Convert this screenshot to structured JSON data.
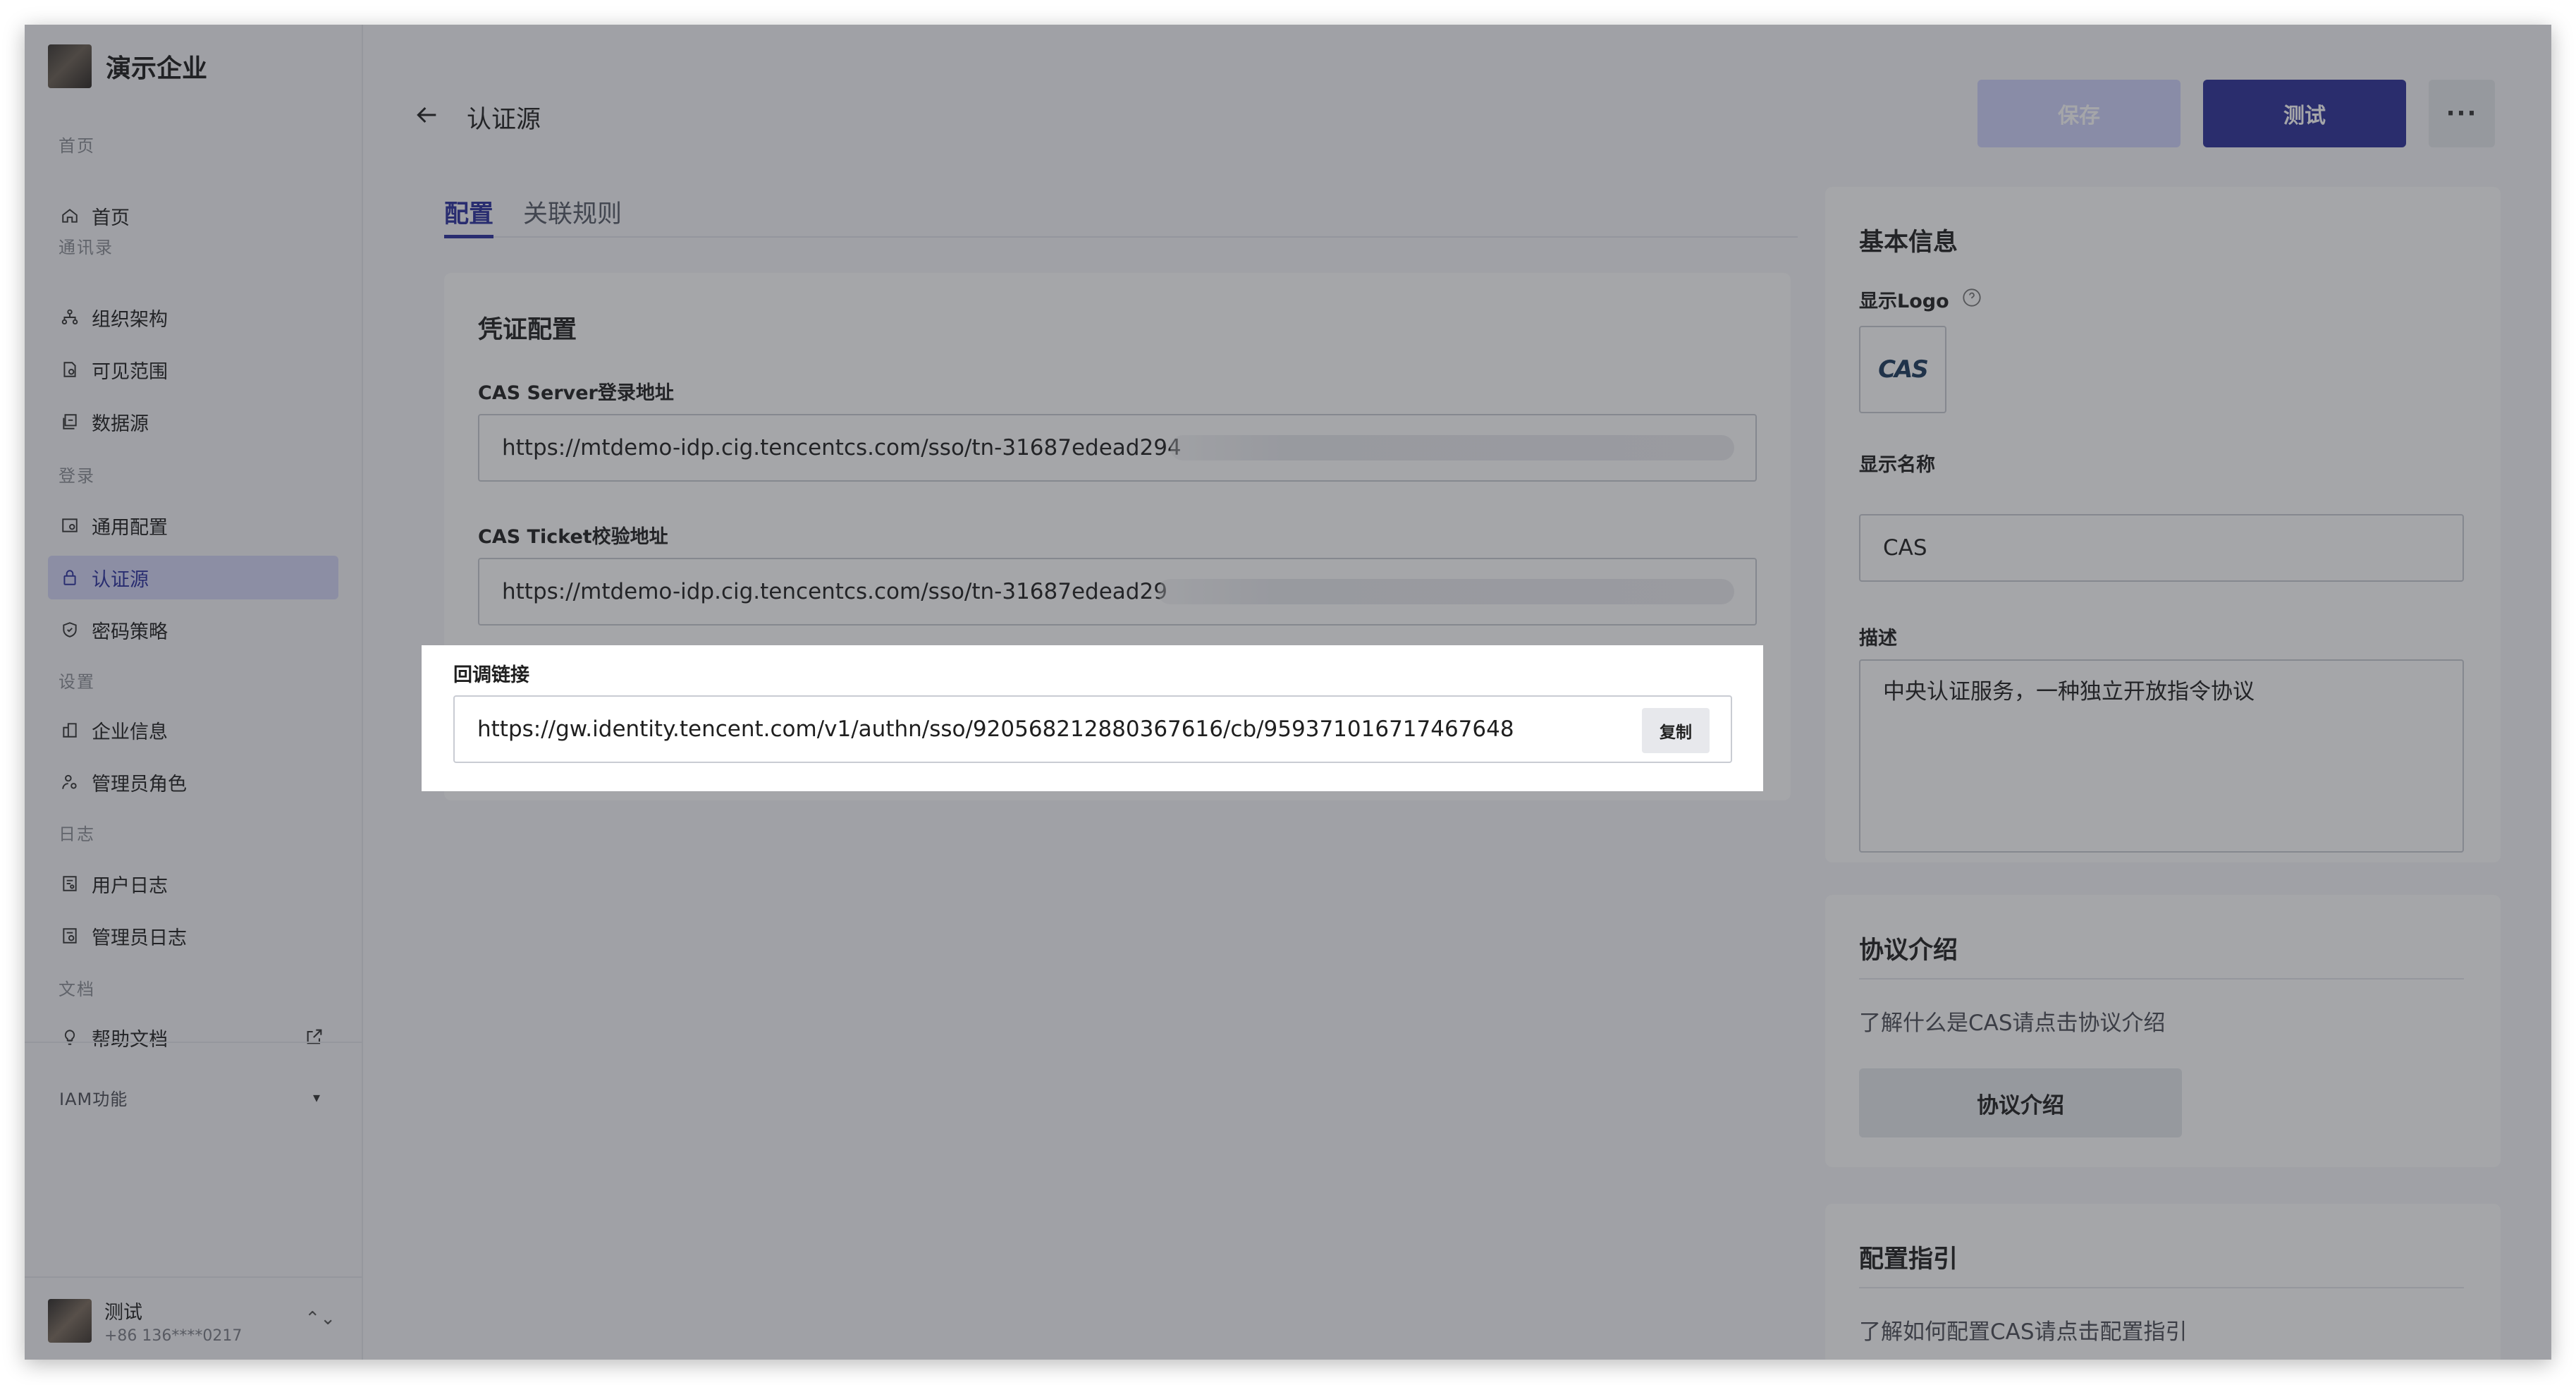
{
  "app": {
    "org_name": "演示企业"
  },
  "sidebar": {
    "sections": {
      "home": "首页",
      "contacts": "通讯录",
      "login": "登录",
      "settings": "设置",
      "logs": "日志",
      "docs": "文档"
    },
    "items": [
      {
        "label": "首页",
        "icon": "home-icon"
      },
      {
        "label": "组织架构",
        "icon": "org-chart-icon"
      },
      {
        "label": "可见范围",
        "icon": "visibility-icon"
      },
      {
        "label": "数据源",
        "icon": "data-source-icon"
      },
      {
        "label": "通用配置",
        "icon": "general-config-icon"
      },
      {
        "label": "认证源",
        "icon": "lock-icon",
        "active": true
      },
      {
        "label": "密码策略",
        "icon": "shield-icon"
      },
      {
        "label": "企业信息",
        "icon": "building-icon"
      },
      {
        "label": "管理员角色",
        "icon": "admin-role-icon"
      },
      {
        "label": "用户日志",
        "icon": "user-log-icon"
      },
      {
        "label": "管理员日志",
        "icon": "admin-log-icon"
      },
      {
        "label": "帮助文档",
        "icon": "bulb-icon"
      }
    ],
    "iam_label": "IAM功能",
    "user": {
      "name": "测试",
      "phone": "+86 136****0217"
    }
  },
  "header": {
    "title": "认证源",
    "save_label": "保存",
    "test_label": "测试",
    "more_label": "···"
  },
  "tabs": [
    {
      "label": "配置",
      "active": true
    },
    {
      "label": "关联规则",
      "active": false
    }
  ],
  "credential": {
    "title": "凭证配置",
    "cas_server_label": "CAS Server登录地址",
    "cas_server_value": "https://mtdemo-idp.cig.tencentcs.com/sso/tn-31687edead294",
    "cas_ticket_label": "CAS Ticket校验地址",
    "cas_ticket_value": "https://mtdemo-idp.cig.tencentcs.com/sso/tn-31687edead29",
    "callback_label": "回调链接",
    "callback_value": "https://gw.identity.tencent.com/v1/authn/sso/920568212880367616/cb/959371016717467648",
    "copy_label": "复制"
  },
  "basic_info": {
    "title": "基本信息",
    "logo_label": "显示Logo",
    "logo_text": "CAS",
    "name_label": "显示名称",
    "name_value": "CAS",
    "desc_label": "描述",
    "desc_value": "中央认证服务，一种独立开放指令协议"
  },
  "protocol": {
    "title": "协议介绍",
    "desc": "了解什么是CAS请点击协议介绍",
    "button": "协议介绍"
  },
  "guide": {
    "title": "配置指引",
    "desc": "了解如何配置CAS请点击配置指引"
  }
}
